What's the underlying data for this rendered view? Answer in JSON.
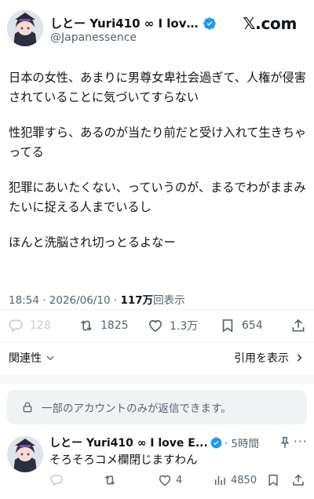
{
  "tweet": {
    "display_name": "️しとー Yuri410 ∞ I love...",
    "handle": "@Japanessence",
    "brand": "𝕏.com",
    "paragraphs": [
      "日本の女性、あまりに男尊女卑社会過ぎて、人権が侵害されていることに気づいてすらない",
      "性犯罪すら、あるのが当たり前だと受け入れて生きちゃってる",
      "犯罪にあいたくない、っていうのが、まるでわがままみたいに捉える人までいるし",
      "ほんと洗脳され切っとるよなー"
    ],
    "timestamp": "18:54 · 2026/06/10 · ",
    "views_count": "117万",
    "views_label": "回表示",
    "stats": {
      "replies": "128",
      "reposts": "1825",
      "likes": "1.3万",
      "bookmarks": "654"
    },
    "related_label": "関連性",
    "quotes_label": "引用を表示"
  },
  "reply_restriction": "一部のアカウントのみが返信できます。",
  "reply": {
    "display_name": "️しとー Yuri410 ∞ I love E...",
    "time": "· 5時間",
    "text": "そろそろコメ欄閉じますわん",
    "stats": {
      "likes": "4",
      "views": "4850"
    }
  },
  "colors": {
    "verified": "#1d9bf0",
    "text_primary": "#0f1419",
    "text_secondary": "#536471",
    "muted_icon": "#c4cdd4"
  }
}
